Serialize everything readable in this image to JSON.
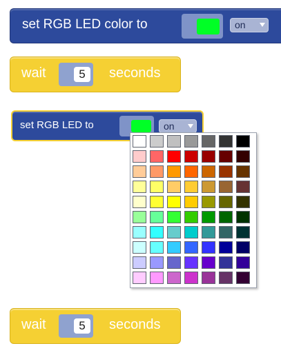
{
  "blocks": {
    "set_color": {
      "label": "set RGB LED color to",
      "color": "#00ff26",
      "state": "on"
    },
    "wait1": {
      "label_pre": "wait",
      "value": "5",
      "label_post": "seconds"
    },
    "set_led": {
      "label": "set RGB LED to",
      "color": "#00ff26",
      "state": "on"
    },
    "wait2": {
      "label_pre": "wait",
      "value": "5",
      "label_post": "seconds"
    }
  },
  "palette": {
    "colors": [
      [
        "#ffffff",
        "#cccccc",
        "#c0c0c0",
        "#999999",
        "#666666",
        "#333333",
        "#000000"
      ],
      [
        "#ffcccc",
        "#ff6666",
        "#ff0000",
        "#cc0000",
        "#990000",
        "#660000",
        "#330000"
      ],
      [
        "#ffcc99",
        "#ff9966",
        "#ff9900",
        "#ff6600",
        "#cc6600",
        "#993300",
        "#663300"
      ],
      [
        "#ffff99",
        "#ffff66",
        "#ffcc66",
        "#ffcc33",
        "#cc9933",
        "#996633",
        "#663333"
      ],
      [
        "#ffffcc",
        "#ffff33",
        "#ffff00",
        "#ffcc00",
        "#999900",
        "#666600",
        "#333300"
      ],
      [
        "#99ff99",
        "#66ff99",
        "#33ff33",
        "#33cc00",
        "#009900",
        "#006600",
        "#003300"
      ],
      [
        "#99ffff",
        "#33ffff",
        "#66cccc",
        "#00cccc",
        "#339999",
        "#336666",
        "#003333"
      ],
      [
        "#ccffff",
        "#66ffff",
        "#33ccff",
        "#3366ff",
        "#3333ff",
        "#000099",
        "#000066"
      ],
      [
        "#ccccff",
        "#9999ff",
        "#6666cc",
        "#6633ff",
        "#6600cc",
        "#333399",
        "#330099"
      ],
      [
        "#ffccff",
        "#ff99ff",
        "#cc66cc",
        "#cc33cc",
        "#993399",
        "#663366",
        "#330033"
      ]
    ]
  }
}
